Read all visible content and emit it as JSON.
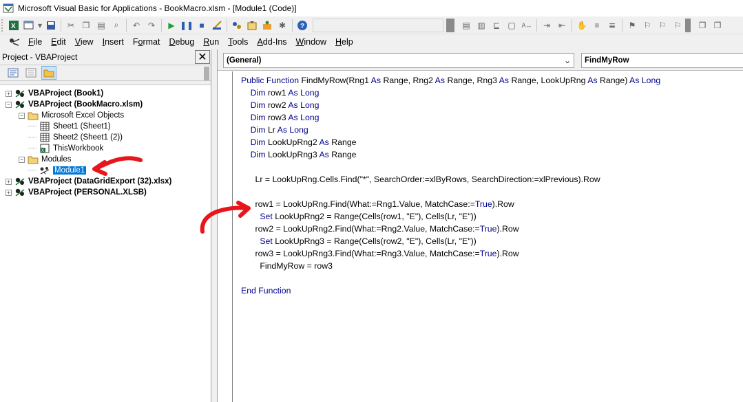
{
  "window": {
    "title": "Microsoft Visual Basic for Applications - BookMacro.xlsm - [Module1 (Code)]"
  },
  "menubar": {
    "items": [
      {
        "label": "File",
        "key": "F"
      },
      {
        "label": "Edit",
        "key": "E"
      },
      {
        "label": "View",
        "key": "V"
      },
      {
        "label": "Insert",
        "key": "I"
      },
      {
        "label": "Format",
        "key": "o"
      },
      {
        "label": "Debug",
        "key": "D"
      },
      {
        "label": "Run",
        "key": "R"
      },
      {
        "label": "Tools",
        "key": "T"
      },
      {
        "label": "Add-Ins",
        "key": "A"
      },
      {
        "label": "Window",
        "key": "W"
      },
      {
        "label": "Help",
        "key": "H"
      }
    ]
  },
  "project_panel": {
    "title": "Project - VBAProject",
    "close_label": "✕",
    "tree": [
      {
        "level": 0,
        "expander": "+",
        "icon": "vba-project-icon",
        "label": "VBAProject (Book1)",
        "bold": true
      },
      {
        "level": 0,
        "expander": "−",
        "icon": "vba-project-icon",
        "label": "VBAProject (BookMacro.xlsm)",
        "bold": true
      },
      {
        "level": 1,
        "expander": "−",
        "icon": "folder-icon",
        "label": "Microsoft Excel Objects",
        "bold": false
      },
      {
        "level": 2,
        "expander": "",
        "icon": "sheet-icon",
        "label": "Sheet1 (Sheet1)",
        "bold": false
      },
      {
        "level": 2,
        "expander": "",
        "icon": "sheet-icon",
        "label": "Sheet2 (Sheet1 (2))",
        "bold": false
      },
      {
        "level": 2,
        "expander": "",
        "icon": "workbook-icon",
        "label": "ThisWorkbook",
        "bold": false
      },
      {
        "level": 1,
        "expander": "−",
        "icon": "folder-icon",
        "label": "Modules",
        "bold": false
      },
      {
        "level": 2,
        "expander": "",
        "icon": "module-icon",
        "label": "Module1",
        "bold": false,
        "selected": true
      },
      {
        "level": 0,
        "expander": "+",
        "icon": "vba-project-icon",
        "label": "VBAProject (DataGridExport (32).xlsx)",
        "bold": true
      },
      {
        "level": 0,
        "expander": "+",
        "icon": "vba-project-icon",
        "label": "VBAProject (PERSONAL.XLSB)",
        "bold": true
      }
    ]
  },
  "editor": {
    "object_combo": "(General)",
    "procedure_combo": "FindMyRow",
    "code_lines": [
      {
        "indent": 0,
        "parts": [
          [
            "kw",
            "Public Function "
          ],
          [
            "t",
            "FindMyRow(Rng1 "
          ],
          [
            "kw",
            "As "
          ],
          [
            "t",
            "Range, Rng2 "
          ],
          [
            "kw",
            "As "
          ],
          [
            "t",
            "Range, Rng3 "
          ],
          [
            "kw",
            "As "
          ],
          [
            "t",
            "Range, LookUpRng "
          ],
          [
            "kw",
            "As "
          ],
          [
            "t",
            "Range) "
          ],
          [
            "kw",
            "As Long"
          ]
        ]
      },
      {
        "indent": 4,
        "parts": [
          [
            "kw",
            "Dim "
          ],
          [
            "t",
            "row1 "
          ],
          [
            "kw",
            "As Long"
          ]
        ]
      },
      {
        "indent": 4,
        "parts": [
          [
            "kw",
            "Dim "
          ],
          [
            "t",
            "row2 "
          ],
          [
            "kw",
            "As Long"
          ]
        ]
      },
      {
        "indent": 4,
        "parts": [
          [
            "kw",
            "Dim "
          ],
          [
            "t",
            "row3 "
          ],
          [
            "kw",
            "As Long"
          ]
        ]
      },
      {
        "indent": 4,
        "parts": [
          [
            "kw",
            "Dim "
          ],
          [
            "t",
            "Lr "
          ],
          [
            "kw",
            "As Long"
          ]
        ]
      },
      {
        "indent": 4,
        "parts": [
          [
            "kw",
            "Dim "
          ],
          [
            "t",
            "LookUpRng2 "
          ],
          [
            "kw",
            "As "
          ],
          [
            "t",
            "Range"
          ]
        ]
      },
      {
        "indent": 4,
        "parts": [
          [
            "kw",
            "Dim "
          ],
          [
            "t",
            "LookUpRng3 "
          ],
          [
            "kw",
            "As "
          ],
          [
            "t",
            "Range"
          ]
        ]
      },
      {
        "indent": 0,
        "parts": []
      },
      {
        "indent": 6,
        "parts": [
          [
            "t",
            "Lr = LookUpRng.Cells.Find(\"*\", SearchOrder:=xlByRows, SearchDirection:=xlPrevious).Row"
          ]
        ]
      },
      {
        "indent": 0,
        "parts": []
      },
      {
        "indent": 6,
        "parts": [
          [
            "t",
            "row1 = LookUpRng.Find(What:=Rng1.Value, MatchCase:="
          ],
          [
            "kw",
            "True"
          ],
          [
            "t",
            ").Row"
          ]
        ]
      },
      {
        "indent": 8,
        "parts": [
          [
            "kw",
            "Set "
          ],
          [
            "t",
            "LookUpRng2 = Range(Cells(row1, \"E\"), Cells(Lr, \"E\"))"
          ]
        ]
      },
      {
        "indent": 6,
        "parts": [
          [
            "t",
            "row2 = LookUpRng2.Find(What:=Rng2.Value, MatchCase:="
          ],
          [
            "kw",
            "True"
          ],
          [
            "t",
            ").Row"
          ]
        ]
      },
      {
        "indent": 8,
        "parts": [
          [
            "kw",
            "Set "
          ],
          [
            "t",
            "LookUpRng3 = Range(Cells(row2, \"E\"), Cells(Lr, \"E\"))"
          ]
        ]
      },
      {
        "indent": 6,
        "parts": [
          [
            "t",
            "row3 = LookUpRng3.Find(What:=Rng3.Value, MatchCase:="
          ],
          [
            "kw",
            "True"
          ],
          [
            "t",
            ").Row"
          ]
        ]
      },
      {
        "indent": 8,
        "parts": [
          [
            "t",
            "FindMyRow = row3"
          ]
        ]
      },
      {
        "indent": 0,
        "parts": []
      },
      {
        "indent": 0,
        "parts": [
          [
            "kw",
            "End Function"
          ]
        ]
      }
    ]
  },
  "colors": {
    "keyword": "#00008b",
    "annotation_arrow": "#e8161b",
    "selection": "#0078d7"
  }
}
